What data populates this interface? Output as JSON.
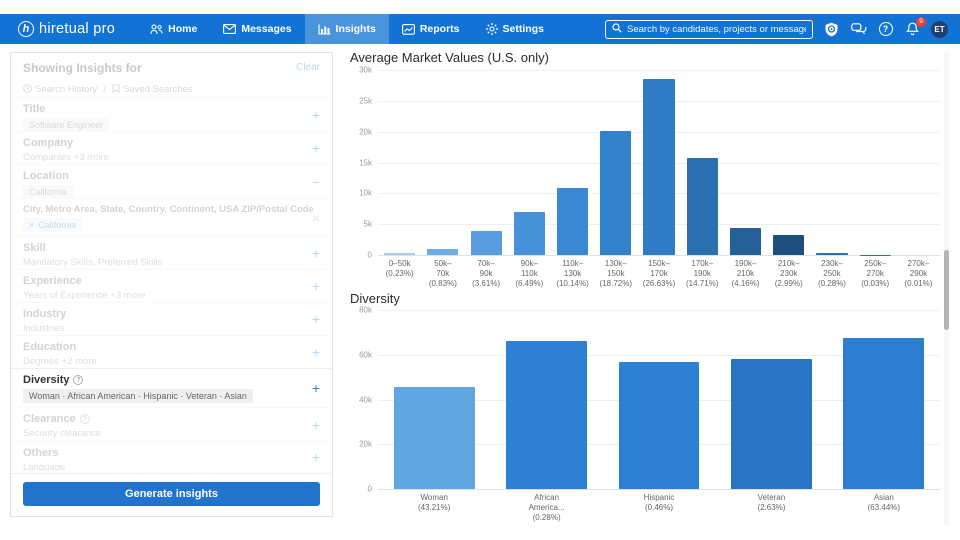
{
  "nav": {
    "logo_text": "hiretual pro",
    "items": [
      {
        "label": "Home",
        "icon": "users-icon",
        "active": false
      },
      {
        "label": "Messages",
        "icon": "envelope-icon",
        "active": false
      },
      {
        "label": "Insights",
        "icon": "bar-chart-icon",
        "active": true
      },
      {
        "label": "Reports",
        "icon": "line-chart-icon",
        "active": false
      },
      {
        "label": "Settings",
        "icon": "gear-icon",
        "active": false
      }
    ],
    "search": {
      "placeholder": "Search by candidates, projects or messages"
    },
    "notification_badge": "9",
    "avatar_initials": "ET",
    "accent_color": "#1273d5",
    "active_tab_color": "#4a94de"
  },
  "sidebar": {
    "header": "Showing Insights for",
    "clear_label": "Clear",
    "history_label": "Search History",
    "saved_label": "Saved Searches",
    "sections": [
      {
        "label": "Title",
        "tag": "Software Engineer",
        "action": "+"
      },
      {
        "label": "Company",
        "sub": "Companies +3 more",
        "action": "+"
      },
      {
        "label": "Location",
        "tag": "California",
        "action": "−"
      },
      {
        "label": "City, Metro Area, State, Country, Continent, USA ZIP/Postal Code",
        "tag": "California",
        "tag_remove": "×",
        "action": "×"
      },
      {
        "label": "Skill",
        "sub": "Mandatory Skills, Preferred Skills",
        "action": "+"
      },
      {
        "label": "Experience",
        "sub": "Years of Experience +3 more",
        "action": "+"
      },
      {
        "label": "Industry",
        "sub": "Industries",
        "action": "+"
      },
      {
        "label": "Education",
        "sub": "Degrees +2 more",
        "action": "+"
      },
      {
        "label": "Diversity",
        "tag": "Woman · African American · Hispanic · Veteran · Asian",
        "action": "+",
        "active": true
      },
      {
        "label": "Clearance",
        "sub": "Security clearance",
        "action": "+"
      },
      {
        "label": "Others",
        "sub": "Language",
        "action": "+"
      }
    ],
    "generate_button": "Generate insights"
  },
  "chart_data": [
    {
      "type": "bar",
      "title": "Average Market Values (U.S. only)",
      "ylim": [
        0,
        30000
      ],
      "yticks": [
        "30k",
        "25k",
        "20k",
        "15k",
        "10k",
        "5k",
        "0"
      ],
      "grid": true,
      "bars": [
        {
          "label_lines": [
            "0–50k",
            "(0.23%)"
          ],
          "percent": 0.23,
          "value": 250,
          "color": "#a9cced"
        },
        {
          "label_lines": [
            "50k–",
            "70k",
            "(0.83%)"
          ],
          "percent": 0.83,
          "value": 900,
          "color": "#6fade5"
        },
        {
          "label_lines": [
            "70k–",
            "90k",
            "(3.61%)"
          ],
          "percent": 3.61,
          "value": 3900,
          "color": "#589ddf"
        },
        {
          "label_lines": [
            "90k–",
            "110k",
            "(6.49%)"
          ],
          "percent": 6.49,
          "value": 6950,
          "color": "#4792d8"
        },
        {
          "label_lines": [
            "110k–",
            "130k",
            "(10.14%)"
          ],
          "percent": 10.14,
          "value": 10900,
          "color": "#3a88d1"
        },
        {
          "label_lines": [
            "130k–",
            "150k",
            "(18.72%)"
          ],
          "percent": 18.72,
          "value": 20100,
          "color": "#3182ca"
        },
        {
          "label_lines": [
            "150k–",
            "170k",
            "(26.63%)"
          ],
          "percent": 26.63,
          "value": 28600,
          "color": "#2d7cc4"
        },
        {
          "label_lines": [
            "170k–",
            "190k",
            "(14.71%)"
          ],
          "percent": 14.71,
          "value": 15750,
          "color": "#2a6fb0"
        },
        {
          "label_lines": [
            "190k–",
            "210k",
            "(4.16%)"
          ],
          "percent": 4.16,
          "value": 4450,
          "color": "#265e97"
        },
        {
          "label_lines": [
            "210k–",
            "230k",
            "(2.99%)"
          ],
          "percent": 2.99,
          "value": 3200,
          "color": "#1e4f7f"
        },
        {
          "label_lines": [
            "230k–",
            "250k",
            "(0.28%)"
          ],
          "percent": 0.28,
          "value": 300,
          "color": "#2a6fb0"
        },
        {
          "label_lines": [
            "250k–",
            "270k",
            "(0.03%)"
          ],
          "percent": 0.03,
          "value": 30,
          "color": "#2a6fb0"
        },
        {
          "label_lines": [
            "270k–",
            "290k",
            "(0.01%)"
          ],
          "percent": 0.01,
          "value": 10,
          "color": "#2a6fb0"
        }
      ]
    },
    {
      "type": "bar",
      "title": "Diversity",
      "ylim": [
        0,
        80000
      ],
      "yticks": [
        "80k",
        "60k",
        "40k",
        "20k",
        "0"
      ],
      "grid": true,
      "bars": [
        {
          "label_lines": [
            "Woman",
            "(43.21%)"
          ],
          "percent": 43.21,
          "value": 45700,
          "color": "#61a6e3"
        },
        {
          "label_lines": [
            "African",
            "America...",
            "(0.28%)"
          ],
          "percent": 0.28,
          "value": 66300,
          "color": "#2e80d3"
        },
        {
          "label_lines": [
            "Hispanic",
            "(0.46%)"
          ],
          "percent": 0.46,
          "value": 56800,
          "color": "#2e80d3"
        },
        {
          "label_lines": [
            "Veteran",
            "(2.63%)"
          ],
          "percent": 2.63,
          "value": 57900,
          "color": "#2a76c5"
        },
        {
          "label_lines": [
            "Asian",
            "(63.44%)"
          ],
          "percent": 63.44,
          "value": 67300,
          "color": "#2d7ed1"
        }
      ]
    }
  ]
}
